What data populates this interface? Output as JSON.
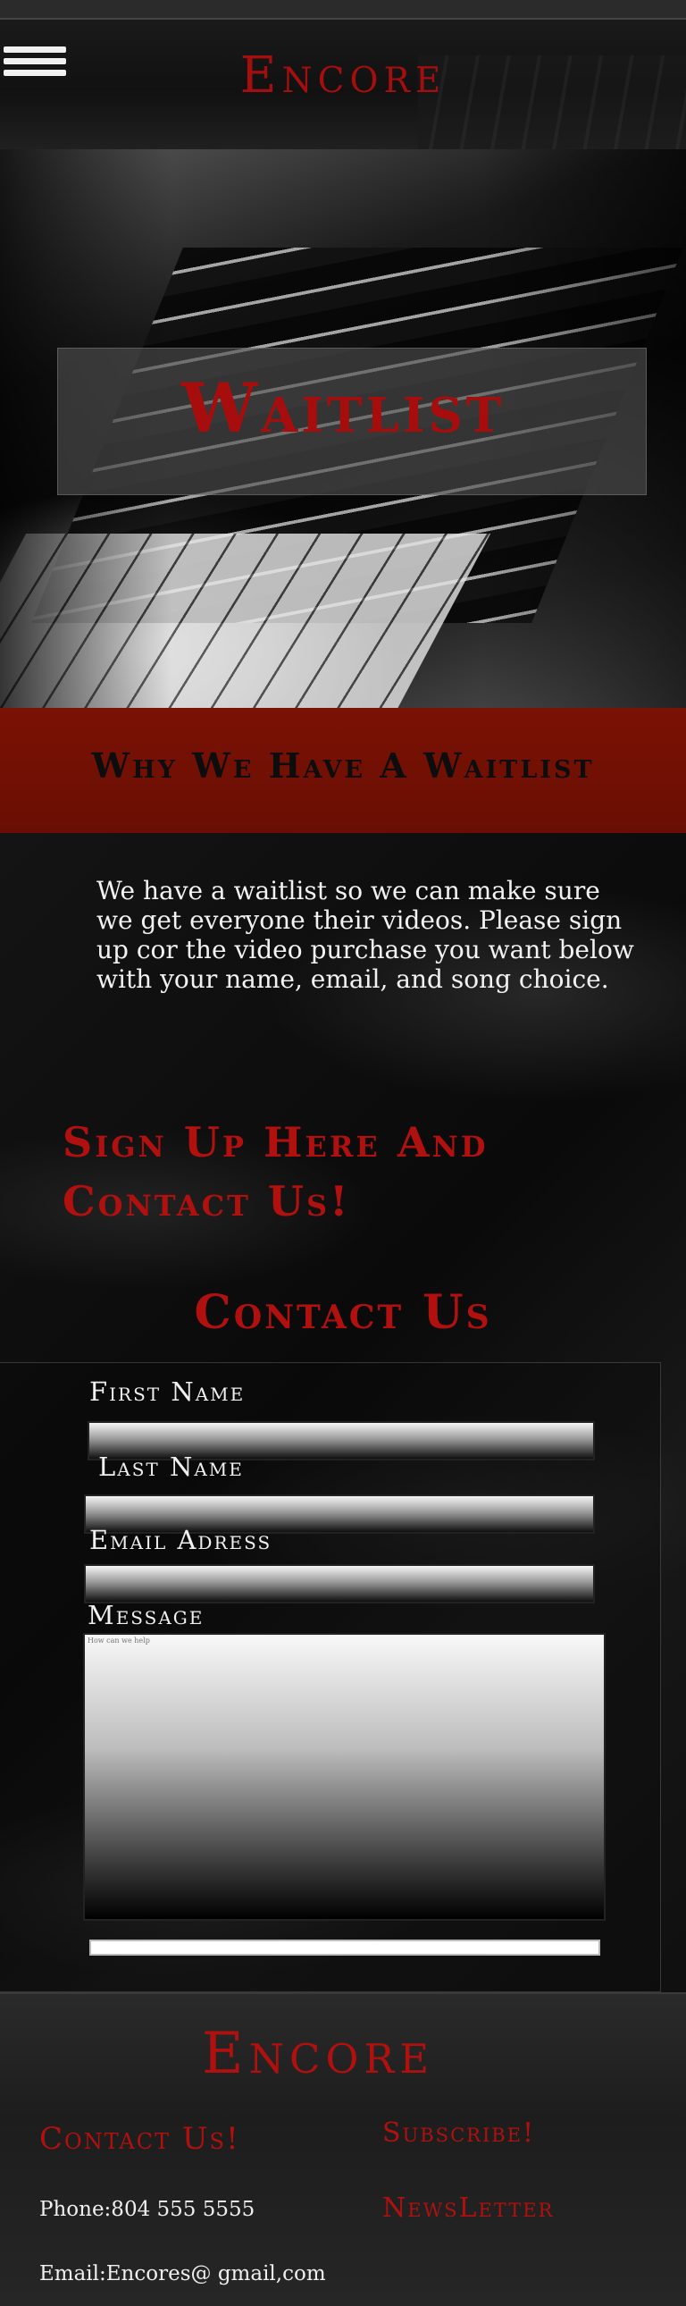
{
  "header": {
    "logo": "Encore",
    "menu_icon": "hamburger-menu-icon"
  },
  "hero": {
    "title": "Waitlist"
  },
  "why": {
    "title": "Why We Have A Waitlist",
    "body": "We have a waitlist so we can make sure we get everyone their videos. Please sign up cor the video purchase you want below with your name, email, and song choice."
  },
  "signup": {
    "title": "Sign Up Here And Contact Us!"
  },
  "contact": {
    "title": "Contact Us",
    "fields": {
      "first_name_label": "First Name",
      "last_name_label": "Last Name",
      "email_label": "Email Adress",
      "message_label": "Message",
      "message_placeholder": "How can we help"
    }
  },
  "footer": {
    "logo": "Encore",
    "contact_link": "Contact Us!",
    "subscribe_link": "Subscribe!",
    "newsletter_link": "NewsLetter",
    "phone": "Phone:804 555 5555",
    "email": "Email:Encores@ gmail,com"
  },
  "colors": {
    "accent_red": "#b0110f",
    "band_red": "#6a0e03",
    "background": "#0b0b0b"
  }
}
